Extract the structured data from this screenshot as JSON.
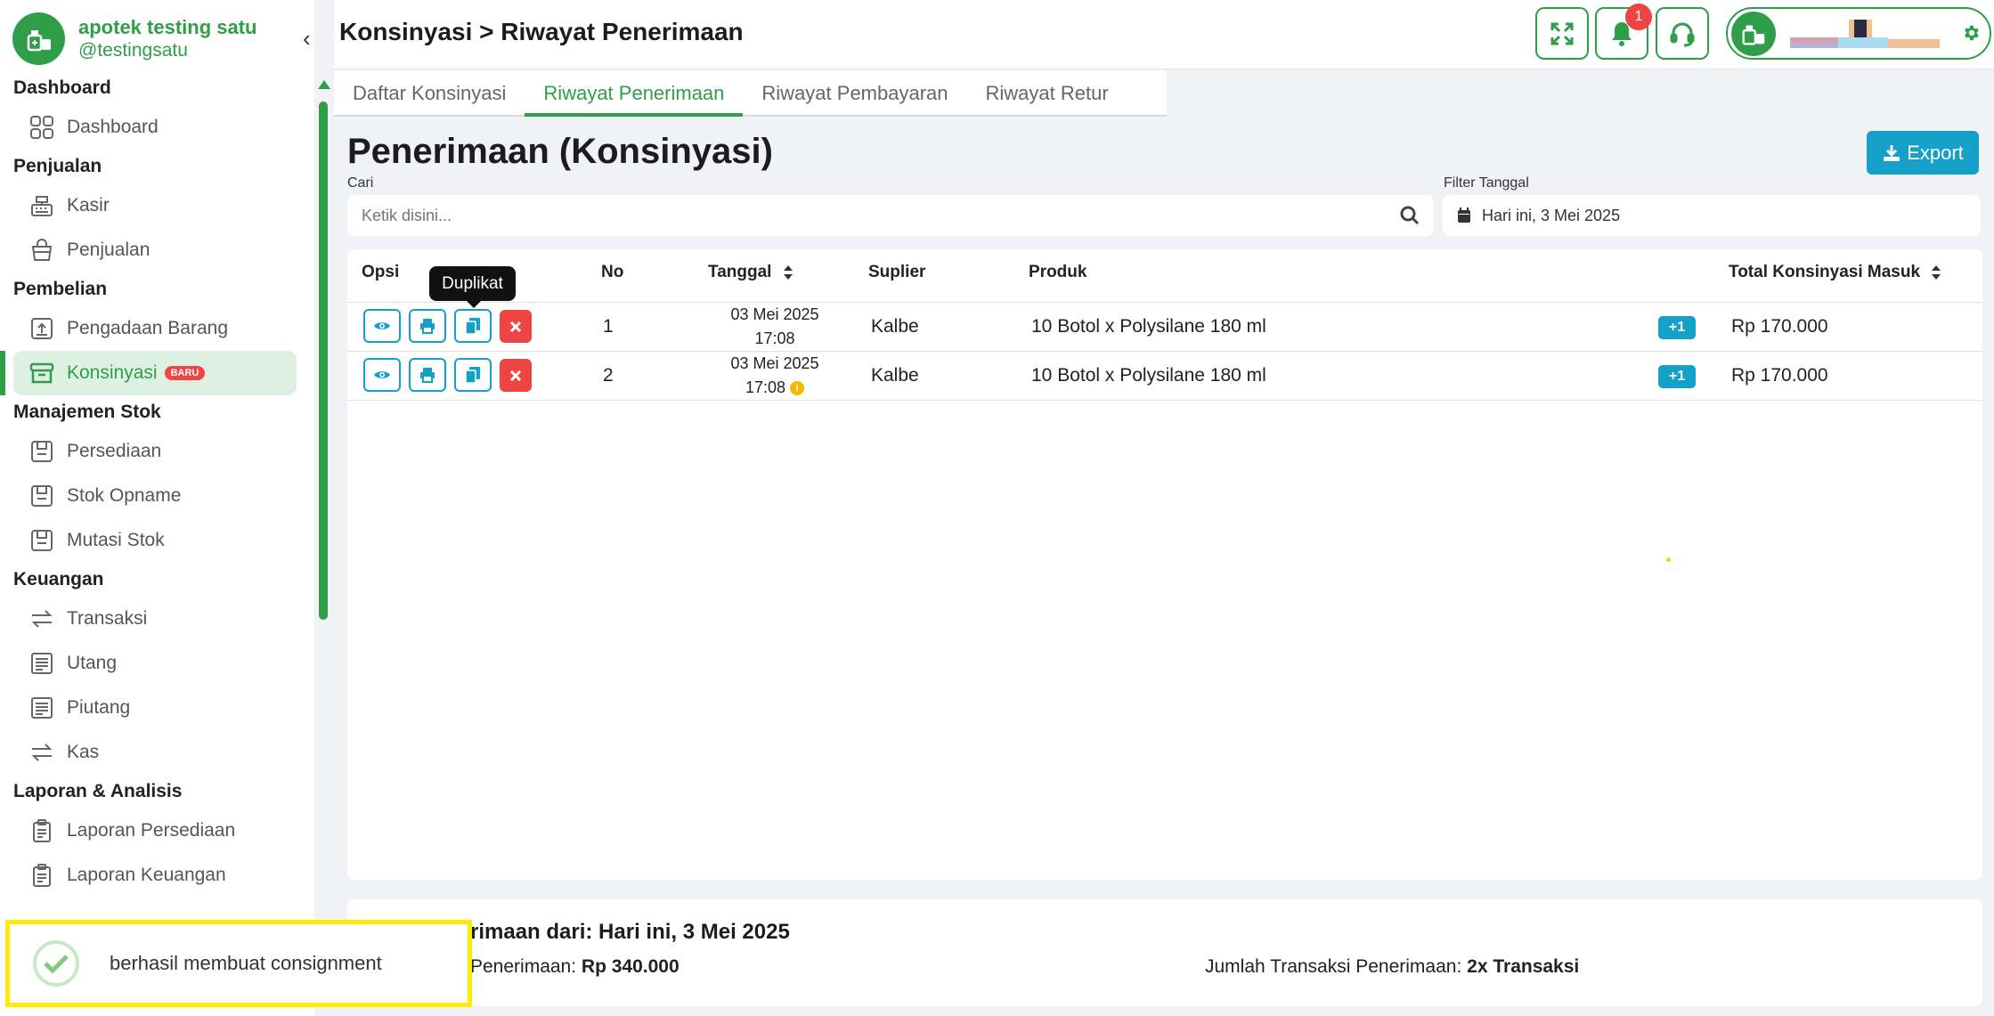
{
  "brand": {
    "name": "apotek testing satu",
    "username": "@testingsatu"
  },
  "sidebar": {
    "collapse_glyph": "‹",
    "sections": [
      {
        "title": "Dashboard",
        "items": [
          {
            "label": "Dashboard",
            "icon": "grid-icon"
          }
        ]
      },
      {
        "title": "Penjualan",
        "items": [
          {
            "label": "Kasir",
            "icon": "cash-register-icon"
          },
          {
            "label": "Penjualan",
            "icon": "shopping-bag-icon"
          }
        ]
      },
      {
        "title": "Pembelian",
        "items": [
          {
            "label": "Pengadaan Barang",
            "icon": "box-upload-icon"
          },
          {
            "label": "Konsinyasi",
            "icon": "archive-icon",
            "badge": "BARU",
            "active": true
          }
        ]
      },
      {
        "title": "Manajemen Stok",
        "items": [
          {
            "label": "Persediaan",
            "icon": "stock-icon"
          },
          {
            "label": "Stok Opname",
            "icon": "stock-icon"
          },
          {
            "label": "Mutasi Stok",
            "icon": "stock-icon"
          }
        ]
      },
      {
        "title": "Keuangan",
        "items": [
          {
            "label": "Transaksi",
            "icon": "transfer-icon"
          },
          {
            "label": "Utang",
            "icon": "ledger-icon"
          },
          {
            "label": "Piutang",
            "icon": "ledger-icon"
          },
          {
            "label": "Kas",
            "icon": "transfer-icon"
          }
        ]
      },
      {
        "title": "Laporan & Analisis",
        "items": [
          {
            "label": "Laporan Persediaan",
            "icon": "clipboard-icon"
          },
          {
            "label": "Laporan Keuangan",
            "icon": "clipboard-icon"
          }
        ]
      }
    ]
  },
  "header": {
    "breadcrumb": "Konsinyasi > Riwayat Penerimaan",
    "notification_count": "1"
  },
  "tabs": [
    {
      "label": "Daftar Konsinyasi",
      "active": false
    },
    {
      "label": "Riwayat Penerimaan",
      "active": true
    },
    {
      "label": "Riwayat Pembayaran",
      "active": false
    },
    {
      "label": "Riwayat Retur",
      "active": false
    }
  ],
  "main": {
    "title": "Penerimaan (Konsinyasi)",
    "export_label": "Export",
    "search_label": "Cari",
    "search_placeholder": "Ketik disini...",
    "filter_label": "Filter Tanggal",
    "filter_value": "Hari ini, 3 Mei 2025"
  },
  "table": {
    "columns": {
      "opsi": "Opsi",
      "no": "No",
      "tanggal": "Tanggal",
      "suplier": "Suplier",
      "produk": "Produk",
      "total": "Total Konsinyasi Masuk"
    },
    "tooltip": "Duplikat",
    "rows": [
      {
        "no": "1",
        "date": "03 Mei 2025",
        "time": "17:08",
        "info": false,
        "supplier": "Kalbe",
        "product": "10 Botol x Polysilane 180 ml",
        "more": "+1",
        "total": "Rp 170.000"
      },
      {
        "no": "2",
        "date": "03 Mei 2025",
        "time": "17:08",
        "info": true,
        "supplier": "Kalbe",
        "product": "10 Botol x Polysilane 180 ml",
        "more": "+1",
        "total": "Rp 170.000"
      }
    ]
  },
  "summary": {
    "title_visible": "rimaan dari: Hari ini, 3 Mei 2025",
    "total_label": "Penerimaan:",
    "total_value": "Rp 340.000",
    "count_label": "Jumlah Transaksi Penerimaan:",
    "count_value": "2x Transaksi"
  },
  "toast": {
    "message": "berhasil membuat consignment"
  },
  "colors": {
    "primary": "#2e9e48",
    "accent": "#14a0c8",
    "danger": "#ef4444",
    "highlight": "#ffec00"
  }
}
